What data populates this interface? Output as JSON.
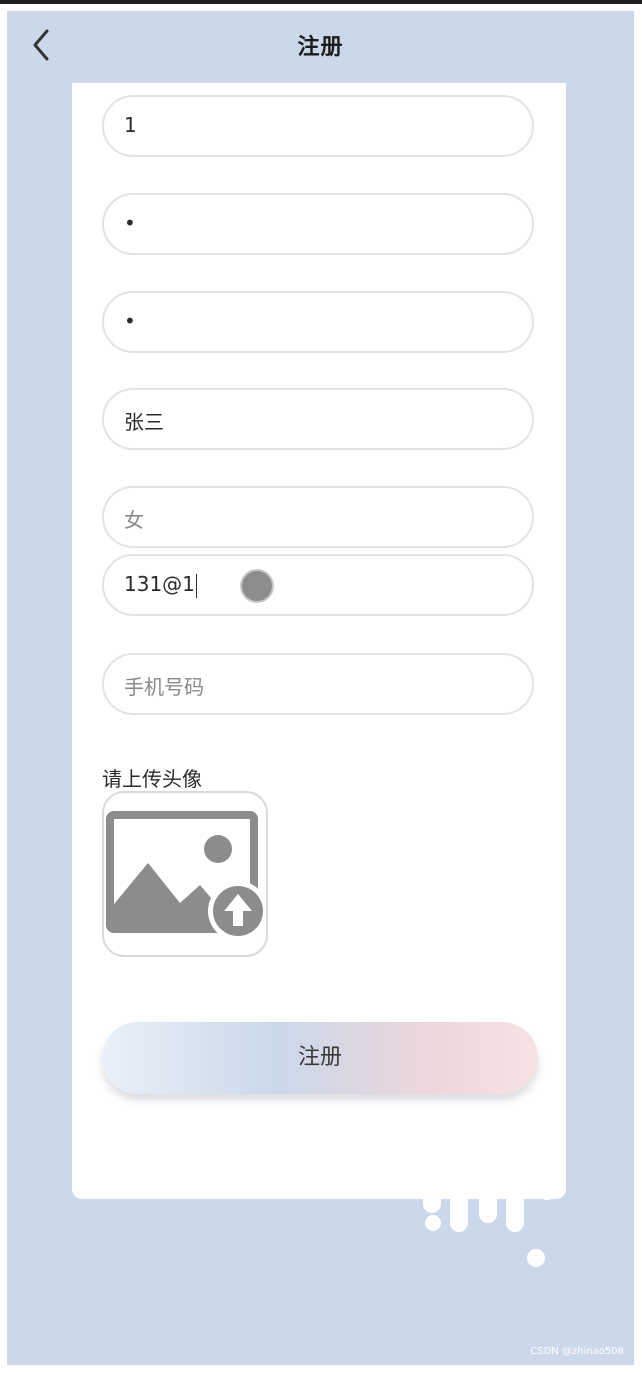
{
  "header": {
    "title": "注册"
  },
  "form": {
    "field1": {
      "value": "1"
    },
    "field2": {
      "value": "•"
    },
    "field3": {
      "value": "•"
    },
    "name": {
      "value": "张三"
    },
    "gender": {
      "placeholder": "女"
    },
    "email": {
      "value": "131@1"
    },
    "phone": {
      "placeholder": "手机号码"
    },
    "upload_label": "请上传头像",
    "submit_label": "注册"
  },
  "icons": {
    "back": "chevron-left-icon",
    "upload": "image-upload-icon"
  },
  "colors": {
    "background": "#cad8ea",
    "card": "#ffffff",
    "field_border": "#e3e3e3",
    "button_gradient_start": "#eaf0f8",
    "button_gradient_mid": "#cad8ea",
    "button_gradient_end": "#f7e2e3"
  },
  "watermark": "CSDN @zhinao508"
}
